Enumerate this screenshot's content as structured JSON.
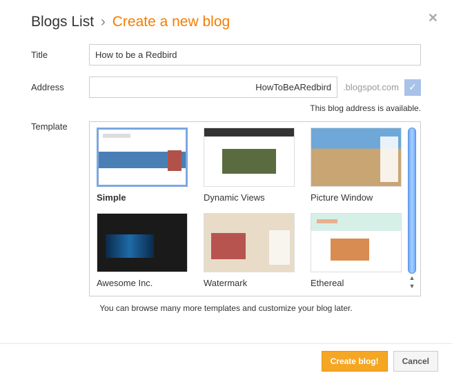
{
  "breadcrumb": {
    "root": "Blogs List",
    "separator": "›",
    "current": "Create a new blog"
  },
  "labels": {
    "title": "Title",
    "address": "Address",
    "template": "Template"
  },
  "fields": {
    "title_value": "How to be a Redbird",
    "address_value": "HowToBeARedbird",
    "address_suffix": ".blogspot.com"
  },
  "status": {
    "availability": "This blog address is available."
  },
  "templates": [
    {
      "id": "simple",
      "label": "Simple",
      "selected": true
    },
    {
      "id": "dynamic-views",
      "label": "Dynamic Views",
      "selected": false
    },
    {
      "id": "picture-window",
      "label": "Picture Window",
      "selected": false
    },
    {
      "id": "awesome-inc",
      "label": "Awesome Inc.",
      "selected": false
    },
    {
      "id": "watermark",
      "label": "Watermark",
      "selected": false
    },
    {
      "id": "ethereal",
      "label": "Ethereal",
      "selected": false
    }
  ],
  "hint": "You can browse many more templates and customize your blog later.",
  "buttons": {
    "create": "Create blog!",
    "cancel": "Cancel"
  },
  "icons": {
    "check": "✓",
    "close": "✕",
    "up": "▲",
    "down": "▼"
  }
}
